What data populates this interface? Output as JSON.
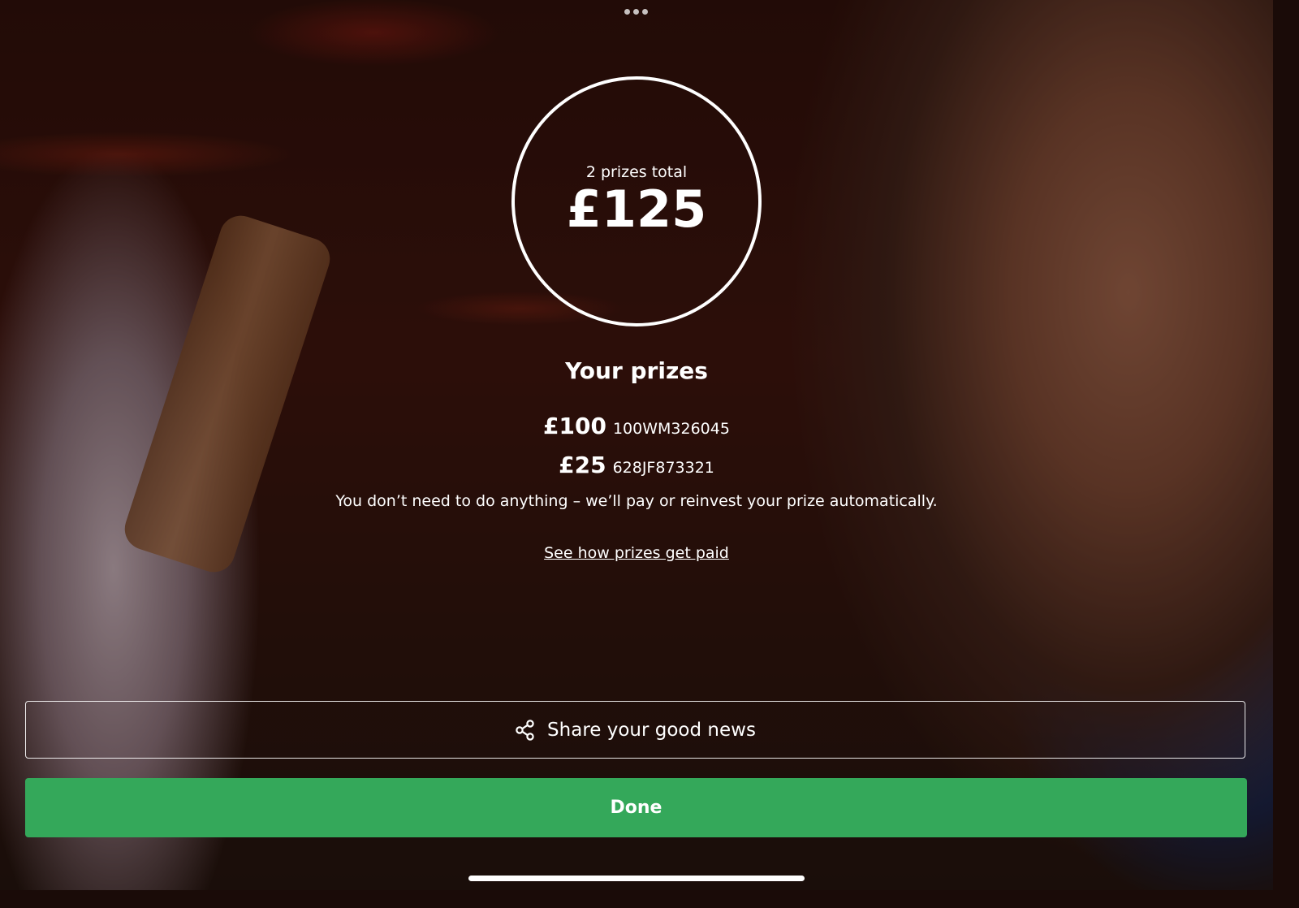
{
  "summary": {
    "total_label": "2 prizes total",
    "total_amount": "£125"
  },
  "prizes": {
    "heading": "Your prizes",
    "items": [
      {
        "amount": "£100",
        "code": "100WM326045"
      },
      {
        "amount": "£25",
        "code": "628JF873321"
      }
    ],
    "info_text": "You don’t need to do anything – we’ll pay or reinvest your prize automatically.",
    "paid_link": "See how prizes get paid"
  },
  "actions": {
    "share_label": "Share your good news",
    "share_icon": "share-icon",
    "done_label": "Done"
  },
  "colors": {
    "done_button": "#34a85a",
    "text": "#ffffff"
  }
}
